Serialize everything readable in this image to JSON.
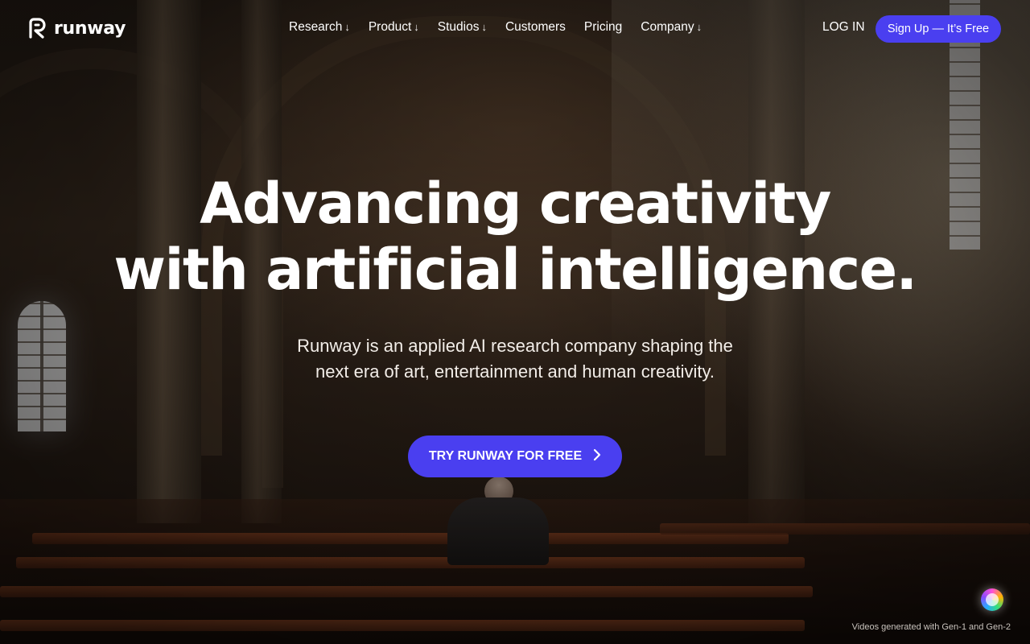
{
  "brand": {
    "name": "runway",
    "accent": "#4a3ff0"
  },
  "nav": {
    "items": [
      {
        "label": "Research",
        "has_dropdown": true
      },
      {
        "label": "Product",
        "has_dropdown": true
      },
      {
        "label": "Studios",
        "has_dropdown": true
      },
      {
        "label": "Customers",
        "has_dropdown": false
      },
      {
        "label": "Pricing",
        "has_dropdown": false
      },
      {
        "label": "Company",
        "has_dropdown": true
      }
    ],
    "dropdown_arrow": "↓",
    "login_label": "LOG IN",
    "signup_label": "Sign Up — It’s Free"
  },
  "hero": {
    "headline_line1": "Advancing creativity",
    "headline_line2": "with artificial intelligence.",
    "subhead_line1": "Runway is an applied AI research company shaping the",
    "subhead_line2": "next era of art, entertainment and human creativity.",
    "cta_label": "TRY RUNWAY FOR FREE",
    "cta_icon": "chevron-right-icon",
    "caption": "Videos generated with Gen-1 and Gen-2"
  }
}
